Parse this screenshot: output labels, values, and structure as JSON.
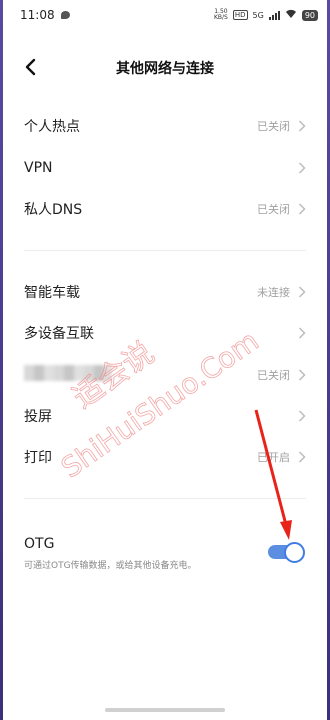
{
  "status_bar": {
    "time": "11:08",
    "speed_value": "1.50",
    "speed_unit": "KB/S",
    "hd": "HD",
    "network": "5G",
    "battery": "90"
  },
  "header": {
    "title": "其他网络与连接"
  },
  "section1": [
    {
      "label": "个人热点",
      "status": "已关闭"
    },
    {
      "label": "VPN",
      "status": ""
    },
    {
      "label": "私人DNS",
      "status": "已关闭"
    }
  ],
  "section2": [
    {
      "label": "智能车载",
      "status": "未连接"
    },
    {
      "label": "多设备互联",
      "status": ""
    },
    {
      "label": "",
      "status": "已关闭"
    },
    {
      "label": "投屏",
      "status": ""
    },
    {
      "label": "打印",
      "status": "已开启"
    }
  ],
  "otg": {
    "label": "OTG",
    "description": "可通过OTG传输数据，或给其他设备充电。",
    "enabled": true
  },
  "watermark": {
    "text_cn": "适会说",
    "text_en": "ShiHuiShuo.Com"
  },
  "colors": {
    "accent": "#3f7ce3",
    "annotation": "#e8241a",
    "status_gray": "#a0a0a0"
  }
}
